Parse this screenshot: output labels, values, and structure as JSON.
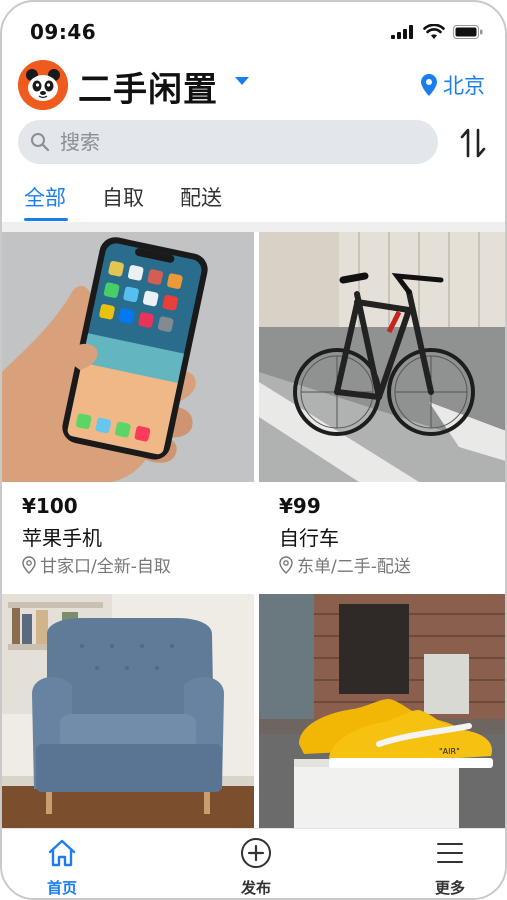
{
  "status_bar": {
    "time": "09:46"
  },
  "header": {
    "app_title": "二手闲置",
    "location": "北京"
  },
  "search": {
    "placeholder": "搜索"
  },
  "tabs": [
    {
      "label": "全部",
      "active": true
    },
    {
      "label": "自取",
      "active": false
    },
    {
      "label": "配送",
      "active": false
    }
  ],
  "items": [
    {
      "price": "¥100",
      "name": "苹果手机",
      "meta": "甘家口/全新-自取",
      "image": "phone-photo"
    },
    {
      "price": "¥99",
      "name": "自行车",
      "meta": "东单/二手-配送",
      "image": "bike-photo"
    },
    {
      "price": "",
      "name": "",
      "meta": "",
      "image": "armchair-photo"
    },
    {
      "price": "",
      "name": "",
      "meta": "",
      "image": "sneakers-photo"
    }
  ],
  "bottom_nav": [
    {
      "label": "首页",
      "icon": "home-icon",
      "active": true
    },
    {
      "label": "发布",
      "icon": "plus-circle-icon",
      "active": false
    },
    {
      "label": "更多",
      "icon": "menu-icon",
      "active": false
    }
  ],
  "colors": {
    "accent": "#1b7ef0",
    "logo_bg": "#ef5b1e",
    "search_bg": "#e3e6ea"
  }
}
